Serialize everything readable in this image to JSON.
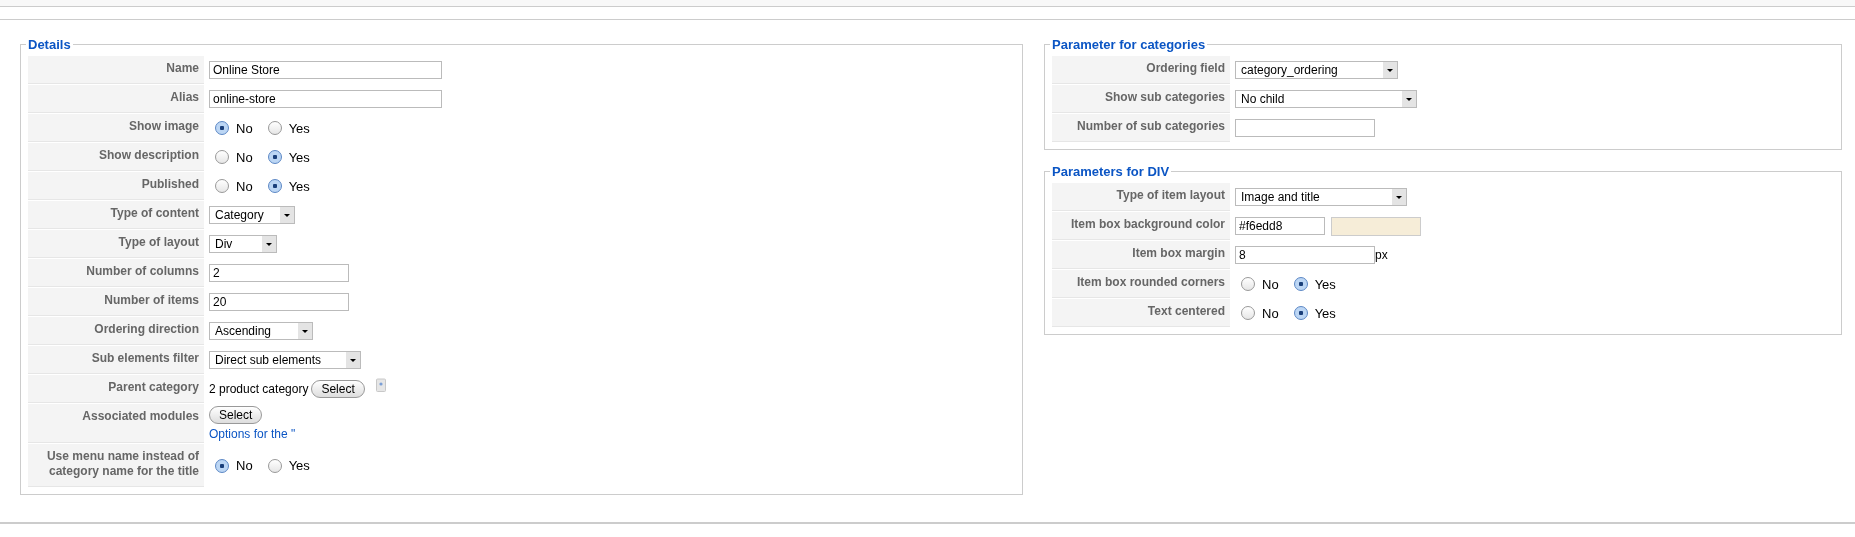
{
  "sections": [
    {
      "title": "Details",
      "rows": [
        {
          "label": "Name",
          "kind": "text",
          "value": "Online Store"
        },
        {
          "label": "Alias",
          "kind": "text",
          "value": "online-store"
        },
        {
          "label": "Show image",
          "kind": "radio",
          "options": [
            {
              "label": "No",
              "selected": true
            },
            {
              "label": "Yes",
              "selected": false
            }
          ]
        },
        {
          "label": "Show description",
          "kind": "radio",
          "options": [
            {
              "label": "No",
              "selected": false
            },
            {
              "label": "Yes",
              "selected": true
            }
          ]
        },
        {
          "label": "Published",
          "kind": "radio",
          "options": [
            {
              "label": "No",
              "selected": false
            },
            {
              "label": "Yes",
              "selected": true
            }
          ]
        },
        {
          "label": "Type of content",
          "kind": "select",
          "value": "Category"
        },
        {
          "label": "Type of layout",
          "kind": "select",
          "value": "Div"
        },
        {
          "label": "Number of columns",
          "kind": "text",
          "value": "2"
        },
        {
          "label": "Number of items",
          "kind": "text",
          "value": "20"
        },
        {
          "label": "Ordering direction",
          "kind": "select",
          "value": "Ascending"
        },
        {
          "label": "Sub elements filter",
          "kind": "select",
          "value": "Direct sub elements"
        },
        {
          "label": "Parent category",
          "kind": "picker",
          "value": "2 product category",
          "button": "Select"
        },
        {
          "label": "Associated modules",
          "kind": "modules",
          "button": "Select",
          "link": "Options for the \""
        },
        {
          "label": "Use menu name instead of category name for the title",
          "kind": "radio",
          "options": [
            {
              "label": "No",
              "selected": true
            },
            {
              "label": "Yes",
              "selected": false
            }
          ]
        }
      ]
    },
    {
      "title": "Parameter for categories",
      "rows": [
        {
          "label": "Ordering field",
          "kind": "select",
          "value": "category_ordering"
        },
        {
          "label": "Show sub categories",
          "kind": "select",
          "value": "No child"
        },
        {
          "label": "Number of sub categories",
          "kind": "text"
        }
      ]
    },
    {
      "title": "Parameters for DIV",
      "rows": [
        {
          "label": "Type of item layout",
          "kind": "select",
          "value": "Image and title"
        },
        {
          "label": "Item box background color",
          "kind": "color",
          "value": "#f6edd8",
          "color": "#f6edd8"
        },
        {
          "label": "Item box margin",
          "kind": "text",
          "value": "8",
          "suffix": "px"
        },
        {
          "label": "Item box rounded corners",
          "kind": "radio",
          "options": [
            {
              "label": "No",
              "selected": false
            },
            {
              "label": "Yes",
              "selected": true
            }
          ]
        },
        {
          "label": "Text centered",
          "kind": "radio",
          "options": [
            {
              "label": "No",
              "selected": false
            },
            {
              "label": "Yes",
              "selected": true
            }
          ]
        }
      ]
    }
  ]
}
